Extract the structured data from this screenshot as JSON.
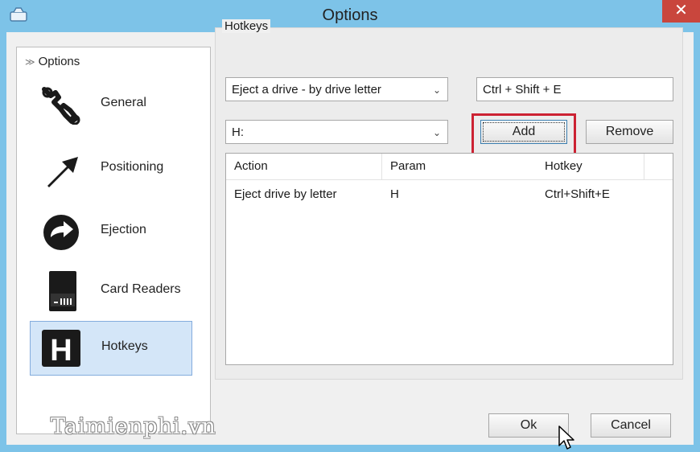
{
  "window": {
    "title": "Options",
    "close_glyph": "✕",
    "app_icon": "drive-icon"
  },
  "sidebar": {
    "header": "Options",
    "header_glyph": "≫",
    "items": [
      {
        "label": "General",
        "icon": "wrench-icon"
      },
      {
        "label": "Positioning",
        "icon": "arrow-icon"
      },
      {
        "label": "Ejection",
        "icon": "eject-arrow-icon"
      },
      {
        "label": "Card Readers",
        "icon": "sd-card-icon"
      },
      {
        "label": "Hotkeys",
        "icon": "hotkey-h-icon",
        "selected": true,
        "glyph": "H"
      }
    ]
  },
  "hotkeys": {
    "group_label": "Hotkeys",
    "action_select": "Eject a drive - by drive letter",
    "hotkey_field": "Ctrl + Shift + E",
    "param_select": "H:",
    "add_label": "Add",
    "remove_label": "Remove",
    "dropdown_glyph": "⌄",
    "table": {
      "columns": [
        "Action",
        "Param",
        "Hotkey"
      ],
      "rows": [
        [
          "Eject drive by letter",
          "H",
          "Ctrl+Shift+E"
        ]
      ]
    }
  },
  "footer": {
    "ok_label": "Ok",
    "cancel_label": "Cancel"
  },
  "watermark": "Taimienphi.vn",
  "colors": {
    "frame": "#7dc3e8",
    "close": "#c9463d",
    "selection": "#d4e6f8",
    "highlight": "#cc2233"
  }
}
